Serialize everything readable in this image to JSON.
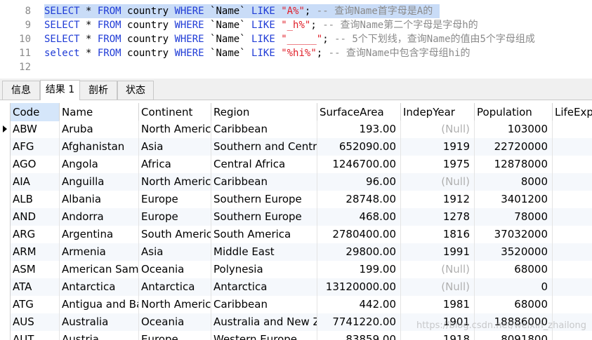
{
  "editor": {
    "lines": [
      {
        "num": "8",
        "selected": true,
        "tokens": [
          {
            "t": "SELECT",
            "c": "kw"
          },
          {
            "t": " * ",
            "c": "tk"
          },
          {
            "t": "FROM",
            "c": "kw"
          },
          {
            "t": " country ",
            "c": "tk"
          },
          {
            "t": "WHERE",
            "c": "kw"
          },
          {
            "t": " `Name` ",
            "c": "tk"
          },
          {
            "t": "LIKE",
            "c": "kw"
          },
          {
            "t": " ",
            "c": "tk"
          },
          {
            "t": "\"A%\"",
            "c": "str"
          },
          {
            "t": "; ",
            "c": "tk"
          },
          {
            "t": "-- 查询Name首字母是A的",
            "c": "cm"
          }
        ]
      },
      {
        "num": "9",
        "selected": false,
        "tokens": [
          {
            "t": "SELECT",
            "c": "kw"
          },
          {
            "t": " * ",
            "c": "tk"
          },
          {
            "t": "FROM",
            "c": "kw"
          },
          {
            "t": " country ",
            "c": "tk"
          },
          {
            "t": "WHERE",
            "c": "kw"
          },
          {
            "t": " `Name` ",
            "c": "tk"
          },
          {
            "t": "LIKE",
            "c": "kw"
          },
          {
            "t": " ",
            "c": "tk"
          },
          {
            "t": "\"_h%\"",
            "c": "str"
          },
          {
            "t": "; ",
            "c": "tk"
          },
          {
            "t": "-- 查询Name第二个字母是字母h的",
            "c": "cm"
          }
        ]
      },
      {
        "num": "10",
        "selected": false,
        "tokens": [
          {
            "t": "SELECT",
            "c": "kw"
          },
          {
            "t": " * ",
            "c": "tk"
          },
          {
            "t": "FROM",
            "c": "kw"
          },
          {
            "t": " country ",
            "c": "tk"
          },
          {
            "t": "WHERE",
            "c": "kw"
          },
          {
            "t": " `Name` ",
            "c": "tk"
          },
          {
            "t": "LIKE",
            "c": "kw"
          },
          {
            "t": " ",
            "c": "tk"
          },
          {
            "t": "\"_____\"",
            "c": "str"
          },
          {
            "t": "; ",
            "c": "tk"
          },
          {
            "t": "-- 5个下划线，查询Name的值由5个字母组成",
            "c": "cm"
          }
        ]
      },
      {
        "num": "11",
        "selected": false,
        "tokens": [
          {
            "t": "select",
            "c": "kw"
          },
          {
            "t": " * ",
            "c": "tk"
          },
          {
            "t": "FROM",
            "c": "kw"
          },
          {
            "t": " country ",
            "c": "tk"
          },
          {
            "t": "WHERE",
            "c": "kw"
          },
          {
            "t": " `Name` ",
            "c": "tk"
          },
          {
            "t": "LIKE",
            "c": "kw"
          },
          {
            "t": " ",
            "c": "tk"
          },
          {
            "t": "\"%hi%\"",
            "c": "str"
          },
          {
            "t": "; ",
            "c": "tk"
          },
          {
            "t": "-- 查询Name中包含字母组hi的",
            "c": "cm"
          }
        ]
      },
      {
        "num": "12",
        "selected": false,
        "tokens": []
      }
    ]
  },
  "tabs": [
    {
      "label": "信息",
      "active": false
    },
    {
      "label": "结果 1",
      "active": true
    },
    {
      "label": "剖析",
      "active": false
    },
    {
      "label": "状态",
      "active": false
    }
  ],
  "grid": {
    "columns": [
      "Code",
      "Name",
      "Continent",
      "Region",
      "SurfaceArea",
      "IndepYear",
      "Population",
      "LifeExp"
    ],
    "rows": [
      [
        "ABW",
        "Aruba",
        "North America",
        "Caribbean",
        "193.00",
        "(Null)",
        "103000"
      ],
      [
        "AFG",
        "Afghanistan",
        "Asia",
        "Southern and Central Asia",
        "652090.00",
        "1919",
        "22720000"
      ],
      [
        "AGO",
        "Angola",
        "Africa",
        "Central Africa",
        "1246700.00",
        "1975",
        "12878000"
      ],
      [
        "AIA",
        "Anguilla",
        "North America",
        "Caribbean",
        "96.00",
        "(Null)",
        "8000"
      ],
      [
        "ALB",
        "Albania",
        "Europe",
        "Southern Europe",
        "28748.00",
        "1912",
        "3401200"
      ],
      [
        "AND",
        "Andorra",
        "Europe",
        "Southern Europe",
        "468.00",
        "1278",
        "78000"
      ],
      [
        "ARG",
        "Argentina",
        "South America",
        "South America",
        "2780400.00",
        "1816",
        "37032000"
      ],
      [
        "ARM",
        "Armenia",
        "Asia",
        "Middle East",
        "29800.00",
        "1991",
        "3520000"
      ],
      [
        "ASM",
        "American Samoa",
        "Oceania",
        "Polynesia",
        "199.00",
        "(Null)",
        "68000"
      ],
      [
        "ATA",
        "Antarctica",
        "Antarctica",
        "Antarctica",
        "13120000.00",
        "(Null)",
        "0"
      ],
      [
        "ATG",
        "Antigua and Barbuda",
        "North America",
        "Caribbean",
        "442.00",
        "1981",
        "68000"
      ],
      [
        "AUS",
        "Australia",
        "Oceania",
        "Australia and New Zealand",
        "7741220.00",
        "1901",
        "18886000"
      ],
      [
        "AUT",
        "Austria",
        "Europe",
        "Western Europe",
        "83859.00",
        "1918",
        "8091800"
      ]
    ],
    "current_row_marker": "▶"
  },
  "watermark": "https://blog.csdn.net/weixin_zhailong"
}
